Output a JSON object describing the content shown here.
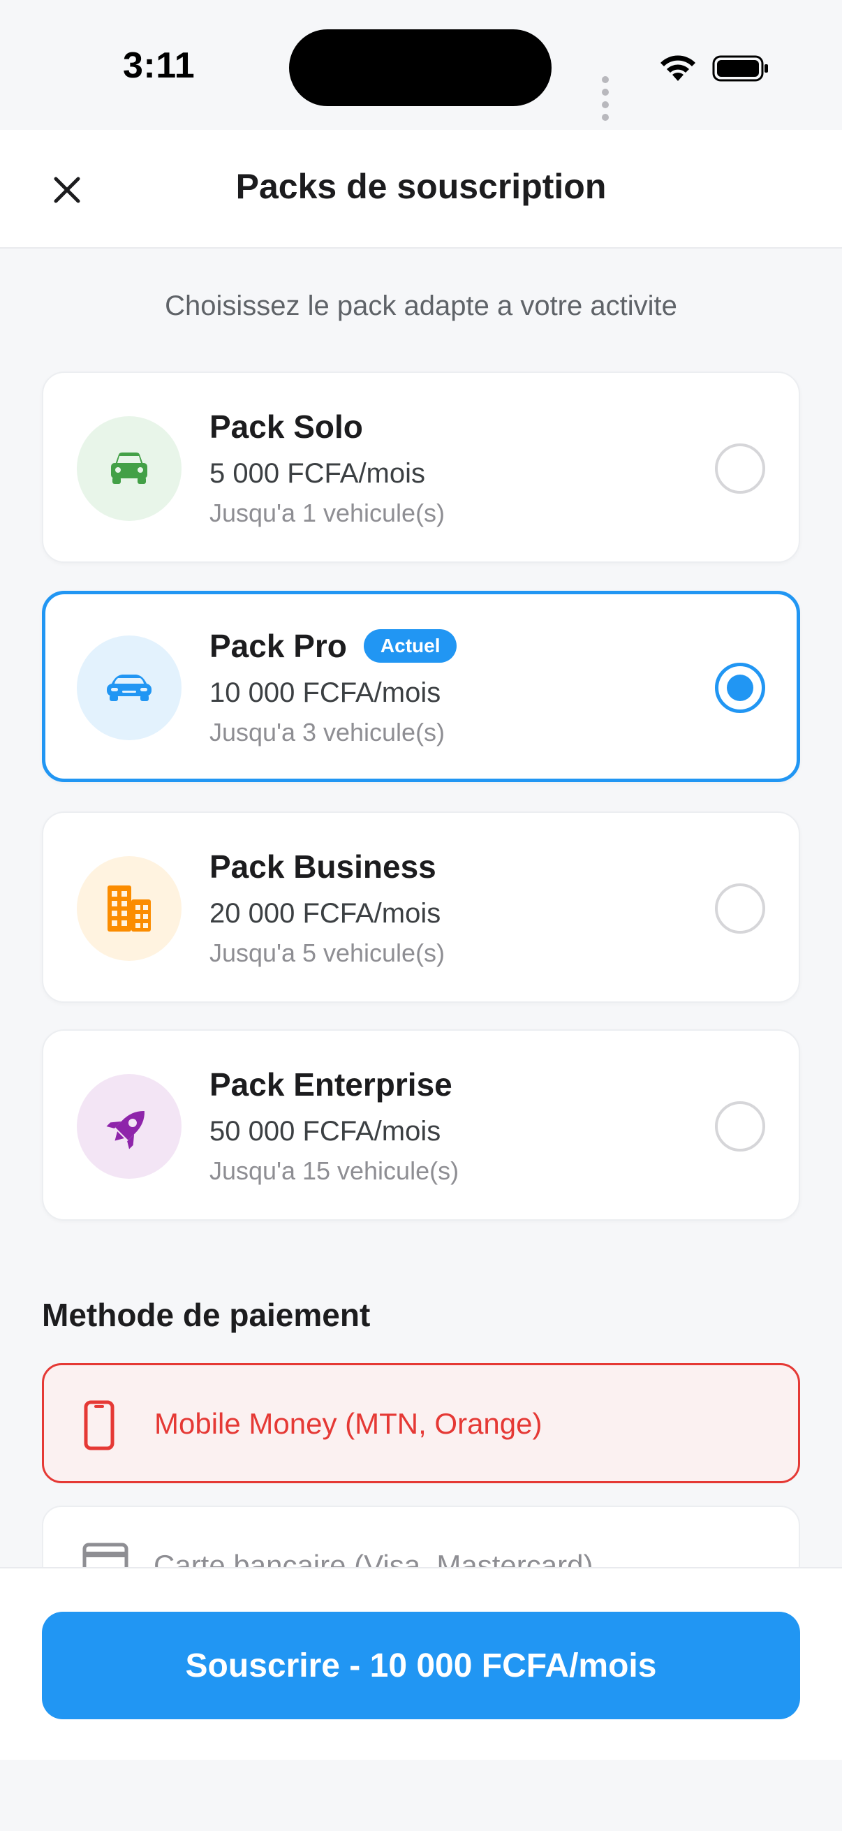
{
  "status_bar": {
    "time": "3:11"
  },
  "header": {
    "title": "Packs de souscription",
    "close_icon": "close-icon"
  },
  "subtitle": "Choisissez le pack adapte a votre activite",
  "packs": [
    {
      "name": "Pack Solo",
      "price": "5 000 FCFA/mois",
      "limit": "Jusqu'a 1 vehicule(s)",
      "icon": "car-icon",
      "icon_color": "#43a047",
      "icon_bg": "#e8f5e9",
      "selected": false
    },
    {
      "name": "Pack Pro",
      "badge": "Actuel",
      "price": "10 000 FCFA/mois",
      "limit": "Jusqu'a 3 vehicule(s)",
      "icon": "sports-car-icon",
      "icon_color": "#2196f3",
      "icon_bg": "#e3f2fd",
      "selected": true
    },
    {
      "name": "Pack Business",
      "price": "20 000 FCFA/mois",
      "limit": "Jusqu'a 5 vehicule(s)",
      "icon": "building-icon",
      "icon_color": "#fb8c00",
      "icon_bg": "#fff3e0",
      "selected": false
    },
    {
      "name": "Pack Enterprise",
      "price": "50 000 FCFA/mois",
      "limit": "Jusqu'a 15 vehicule(s)",
      "icon": "rocket-icon",
      "icon_color": "#8e24aa",
      "icon_bg": "#f3e5f5",
      "selected": false
    }
  ],
  "payment": {
    "title": "Methode de paiement",
    "options": [
      {
        "label": "Mobile Money (MTN, Orange)",
        "icon": "phone-icon",
        "selected": true,
        "color": "#e53935"
      },
      {
        "label": "Carte bancaire (Visa, Mastercard)",
        "icon": "credit-card-icon",
        "selected": false
      }
    ]
  },
  "cta": {
    "label": "Souscrire - 10 000 FCFA/mois",
    "color": "#2196f3"
  }
}
